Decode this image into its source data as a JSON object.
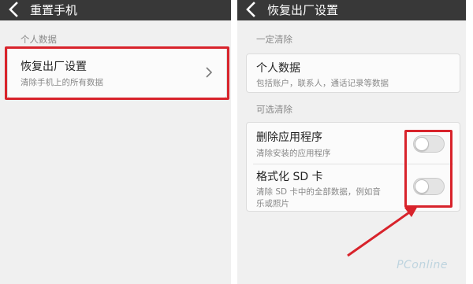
{
  "left_screen": {
    "title": "重置手机",
    "section_label": "个人数据",
    "item": {
      "title": "恢复出厂设置",
      "description": "清除手机上的所有数据"
    }
  },
  "right_screen": {
    "title": "恢复出厂设置",
    "must_clear_label": "一定清除",
    "personal_data": {
      "title": "个人数据",
      "description": "包括账户，联系人，通话记录等数据"
    },
    "optional_label": "可选清除",
    "delete_apps": {
      "title": "删除应用程序",
      "description": "清除安装的应用程序",
      "enabled": false
    },
    "format_sd": {
      "title": "格式化 SD 卡",
      "description_line1": "清除 SD 卡中的全部数据，例如音",
      "description_line2": "乐或照片",
      "enabled": false
    }
  },
  "annotation_color": "#d8232b",
  "watermark": "PConline"
}
